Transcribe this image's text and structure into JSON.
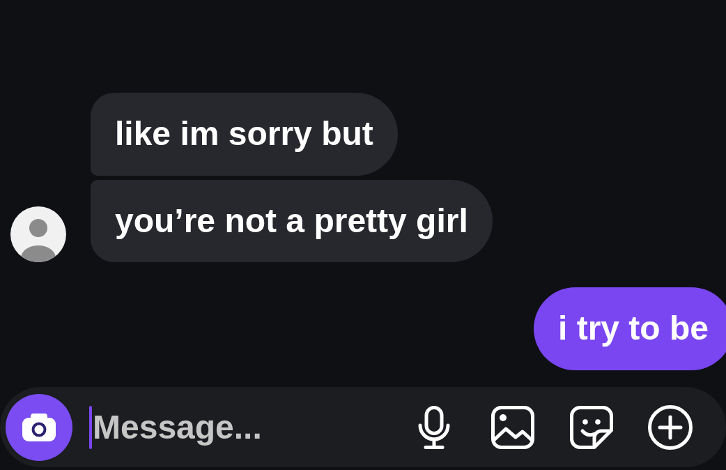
{
  "messages": [
    {
      "kind": "received",
      "text": "like im sorry but"
    },
    {
      "kind": "received",
      "text": "you’re not a pretty girl"
    },
    {
      "kind": "sent",
      "text": "i try to be"
    }
  ],
  "composer": {
    "placeholder": "Message..."
  }
}
